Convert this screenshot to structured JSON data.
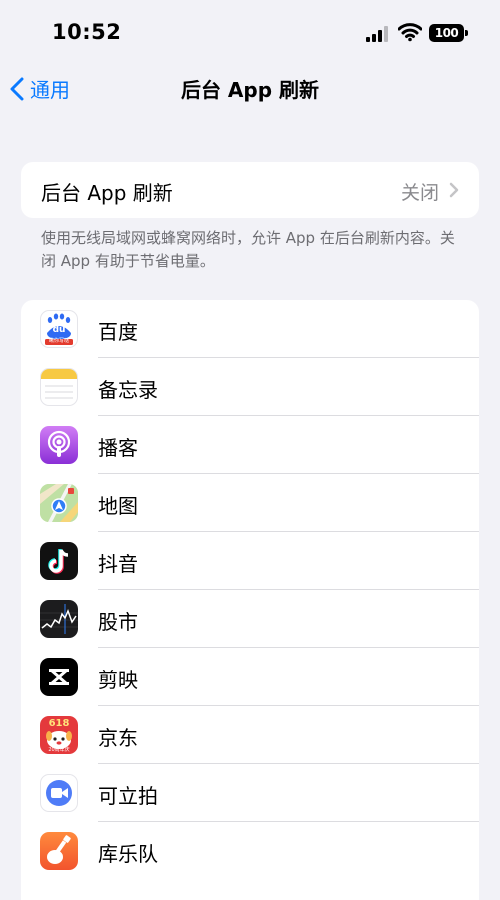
{
  "status_bar": {
    "time": "10:52",
    "battery": "100"
  },
  "nav": {
    "back_label": "通用",
    "title": "后台 App 刷新"
  },
  "setting": {
    "label": "后台 App 刷新",
    "value": "关闭"
  },
  "footnote": "使用无线局域网或蜂窝网络时，允许 App 在后台刷新内容。关闭 App 有助于节省电量。",
  "apps": [
    {
      "name": "百度",
      "icon": "baidu-icon"
    },
    {
      "name": "备忘录",
      "icon": "notes-icon"
    },
    {
      "name": "播客",
      "icon": "podcasts-icon"
    },
    {
      "name": "地图",
      "icon": "maps-icon"
    },
    {
      "name": "抖音",
      "icon": "douyin-icon"
    },
    {
      "name": "股市",
      "icon": "stocks-icon"
    },
    {
      "name": "剪映",
      "icon": "capcut-icon"
    },
    {
      "name": "京东",
      "icon": "jd-icon"
    },
    {
      "name": "可立拍",
      "icon": "clips-icon"
    },
    {
      "name": "库乐队",
      "icon": "garageband-icon"
    }
  ],
  "icon_text": {
    "baidu": "du",
    "baidu_sub": "瞅你写哒",
    "jd": "618",
    "jd_sub": "20周年庆"
  },
  "colors": {
    "accent": "#0a7aff",
    "background": "#f2f2f7",
    "secondary_text": "#8a8a8e"
  }
}
